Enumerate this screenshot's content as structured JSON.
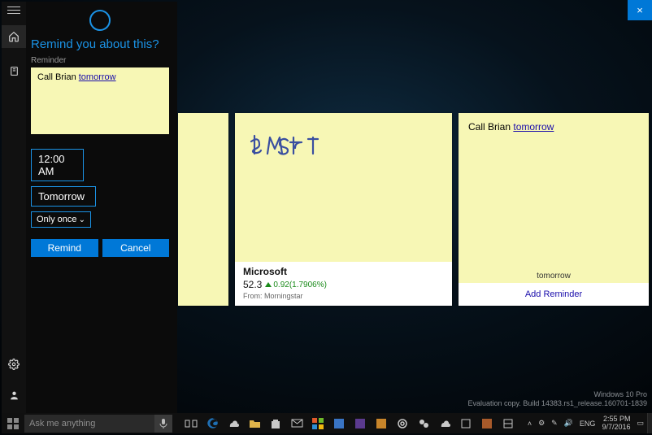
{
  "close_label": "×",
  "cortana": {
    "title": "Remind you about this?",
    "subtitle": "Reminder",
    "note_text_prefix": "Call Brian ",
    "note_link": "tomorrow",
    "time": "12:00 AM",
    "day": "Tomorrow",
    "recurrence": "Only once",
    "remind_btn": "Remind",
    "cancel_btn": "Cancel"
  },
  "notes": {
    "msft": {
      "ink": "$MSFT",
      "company": "Microsoft",
      "price": "52.3",
      "delta": "0.92(1.7906%)",
      "source": "From: Morningstar"
    },
    "call": {
      "text_prefix": "Call Brian ",
      "link": "tomorrow",
      "insight_label": "tomorrow",
      "action": "Add Reminder"
    }
  },
  "search_placeholder": "Ask me anything",
  "watermark": {
    "l1": "Windows 10 Pro",
    "l2": "Evaluation copy. Build 14383.rs1_release.160701-1839"
  },
  "tray": {
    "lang": "ENG",
    "time": "2:55 PM",
    "date": "9/7/2016"
  }
}
